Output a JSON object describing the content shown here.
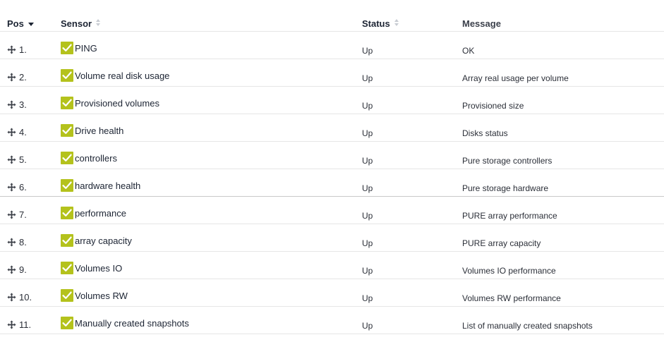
{
  "columns": {
    "pos": "Pos",
    "sensor": "Sensor",
    "status": "Status",
    "message": "Message"
  },
  "colors": {
    "check": "#b4c21c"
  },
  "rows": [
    {
      "pos": "1.",
      "sensor": "PING",
      "status": "Up",
      "message": "OK"
    },
    {
      "pos": "2.",
      "sensor": "Volume real disk usage",
      "status": "Up",
      "message": "Array real usage per volume"
    },
    {
      "pos": "3.",
      "sensor": "Provisioned volumes",
      "status": "Up",
      "message": "Provisioned size"
    },
    {
      "pos": "4.",
      "sensor": "Drive health",
      "status": "Up",
      "message": "Disks status"
    },
    {
      "pos": "5.",
      "sensor": "controllers",
      "status": "Up",
      "message": "Pure storage controllers"
    },
    {
      "pos": "6.",
      "sensor": "hardware health",
      "status": "Up",
      "message": "Pure storage hardware"
    },
    {
      "pos": "7.",
      "sensor": "performance",
      "status": "Up",
      "message": "PURE array performance"
    },
    {
      "pos": "8.",
      "sensor": "array capacity",
      "status": "Up",
      "message": "PURE array capacity"
    },
    {
      "pos": "9.",
      "sensor": "Volumes IO",
      "status": "Up",
      "message": "Volumes IO performance"
    },
    {
      "pos": "10.",
      "sensor": "Volumes RW",
      "status": "Up",
      "message": "Volumes RW performance"
    },
    {
      "pos": "11.",
      "sensor": "Manually created snapshots",
      "status": "Up",
      "message": "List of manually created snapshots"
    }
  ]
}
